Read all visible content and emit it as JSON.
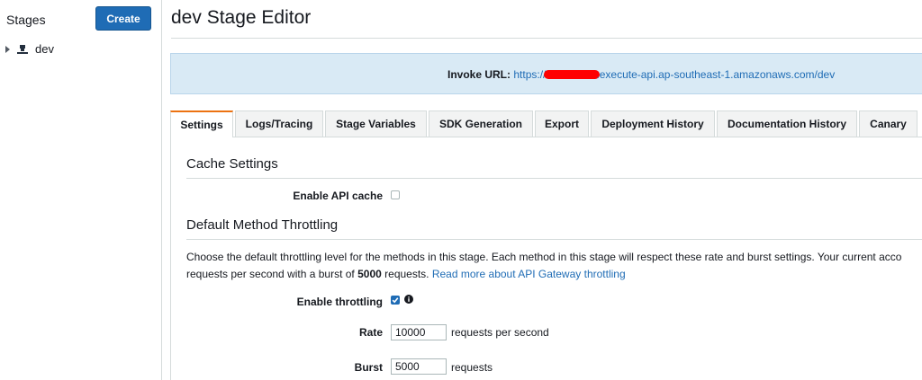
{
  "sidebar": {
    "title": "Stages",
    "create_label": "Create",
    "stages": [
      {
        "name": "dev",
        "icon": "stage-icon"
      }
    ]
  },
  "main": {
    "title": "dev Stage Editor",
    "invoke": {
      "label": "Invoke URL:",
      "url_prefix": "https://",
      "url_suffix": ".execute-api.ap-southeast-1.amazonaws.com/dev"
    },
    "tabs": [
      {
        "label": "Settings",
        "active": true
      },
      {
        "label": "Logs/Tracing"
      },
      {
        "label": "Stage Variables"
      },
      {
        "label": "SDK Generation"
      },
      {
        "label": "Export"
      },
      {
        "label": "Deployment History"
      },
      {
        "label": "Documentation History"
      },
      {
        "label": "Canary"
      }
    ],
    "cache": {
      "section_title": "Cache Settings",
      "enable_label": "Enable API cache",
      "enabled": false
    },
    "throttling": {
      "section_title": "Default Method Throttling",
      "desc_line1": "Choose the default throttling level for the methods in this stage. Each method in this stage will respect these rate and burst settings. Your current acco",
      "desc_line2_pre": "requests per second with a burst of ",
      "desc_line2_bold": "5000",
      "desc_line2_post": " requests. ",
      "desc_link": "Read more about API Gateway throttling",
      "enable_label": "Enable throttling",
      "enabled": true,
      "rate_label": "Rate",
      "rate_value": "10000",
      "rate_unit": "requests per second",
      "burst_label": "Burst",
      "burst_value": "5000",
      "burst_unit": "requests"
    }
  },
  "colors": {
    "accent_blue": "#1f6cb5",
    "tab_active_border": "#ec7211",
    "info_bg": "#d9eaf5",
    "redaction": "#ff0000"
  }
}
